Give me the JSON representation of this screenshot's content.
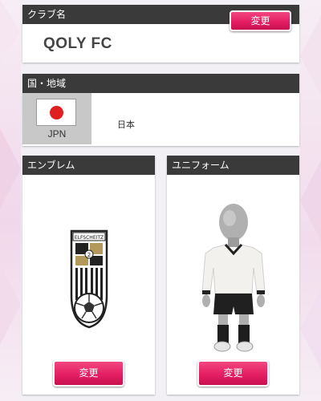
{
  "club": {
    "header": "クラブ名",
    "name": "QOLY FC",
    "change_label": "変更"
  },
  "country": {
    "header": "国・地域",
    "code": "JPN",
    "name": "日本",
    "flag_icon": "japan-flag-icon"
  },
  "emblem": {
    "header": "エンブレム",
    "icon": "club-emblem-icon",
    "change_label": "変更"
  },
  "uniform": {
    "header": "ユニフォーム",
    "icon": "player-uniform-avatar",
    "change_label": "変更"
  },
  "colors": {
    "header_bg": "#3a3a3a",
    "accent": "#e41f63",
    "flag_red": "#e02020"
  }
}
